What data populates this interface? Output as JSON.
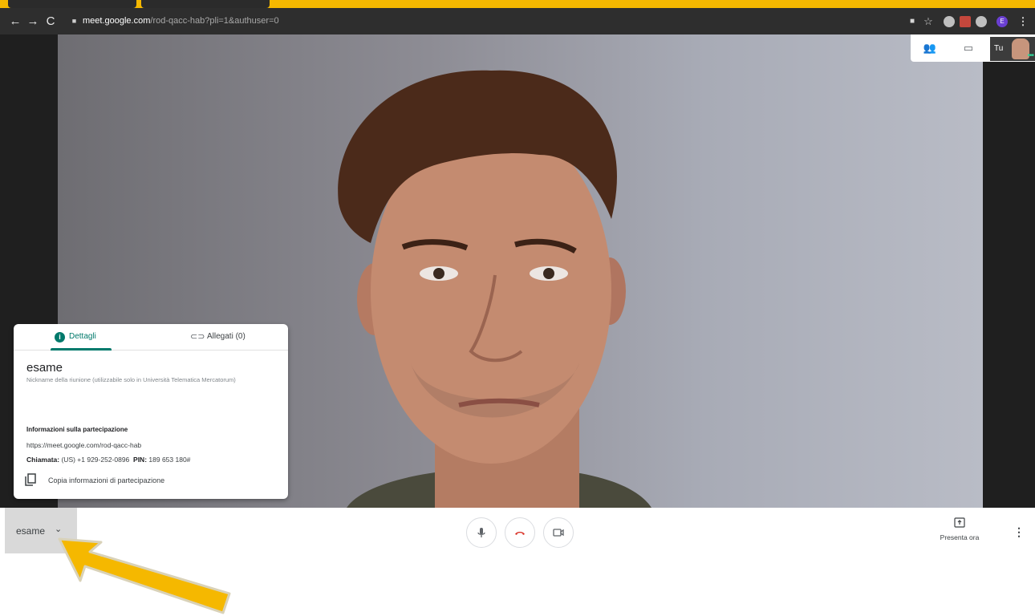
{
  "browser": {
    "url_host": "meet.google.com",
    "url_path": "/rod-qacc-hab?pli=1&authuser=0",
    "profile_initial": "E"
  },
  "self_view": {
    "label": "Tu"
  },
  "details_panel": {
    "tab_details": "Dettagli",
    "tab_attachments": "Allegati (0)",
    "meeting_title": "esame",
    "nickname_note": "Nickname della riunione (utilizzabile solo in Università Telematica Mercatorum)",
    "join_info_heading": "Informazioni sulla partecipazione",
    "join_url": "https://meet.google.com/rod-qacc-hab",
    "call_label": "Chiamata:",
    "call_number": "(US) +1 929-252-0896",
    "pin_label": "PIN:",
    "pin_value": "189 653 180#",
    "copy_label": "Copia informazioni di partecipazione"
  },
  "bottom_bar": {
    "meeting_name": "esame",
    "present_label": "Presenta ora"
  },
  "colors": {
    "accent": "#00796b",
    "hangup": "#d93025",
    "annotation_arrow": "#f5b800"
  }
}
